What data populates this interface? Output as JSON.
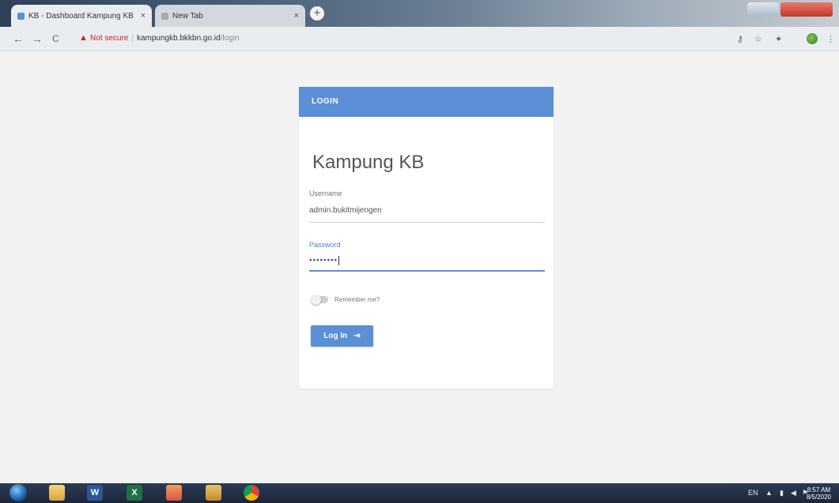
{
  "browser": {
    "tabs": [
      {
        "title": "KB - Dashboard Kampung KB",
        "close": "×"
      },
      {
        "title": "New Tab",
        "close": "×"
      }
    ],
    "new_tab_symbol": "+",
    "nav": {
      "back": "←",
      "forward": "→",
      "reload": "C"
    },
    "security_label": "Not secure",
    "url_host": "kampungkb.bkkbn.go.id",
    "url_path": "/login",
    "toolbar_icons": [
      "star-icon",
      "translate-icon",
      "extension-icon",
      "profile-icon"
    ]
  },
  "login": {
    "header": "LOGIN",
    "app_title": "Kampung KB",
    "username_label": "Username",
    "username_value": "admin.bukitmijengen",
    "password_label": "Password",
    "password_value": "••••••••",
    "remember_label": "Remember me?",
    "login_button": "Log In",
    "login_arrow": "⇥"
  },
  "taskbar": {
    "apps": [
      "explorer",
      "word",
      "excel",
      "paint",
      "folder",
      "chrome"
    ],
    "app_labels": {
      "word": "W",
      "excel": "X"
    },
    "tray_lang": "EN",
    "clock_time": "8:57 AM",
    "clock_date": "8/5/2020"
  },
  "colors": {
    "primary": "#5b8fd6",
    "page_bg": "#f2f2f2",
    "title": "#555555"
  }
}
